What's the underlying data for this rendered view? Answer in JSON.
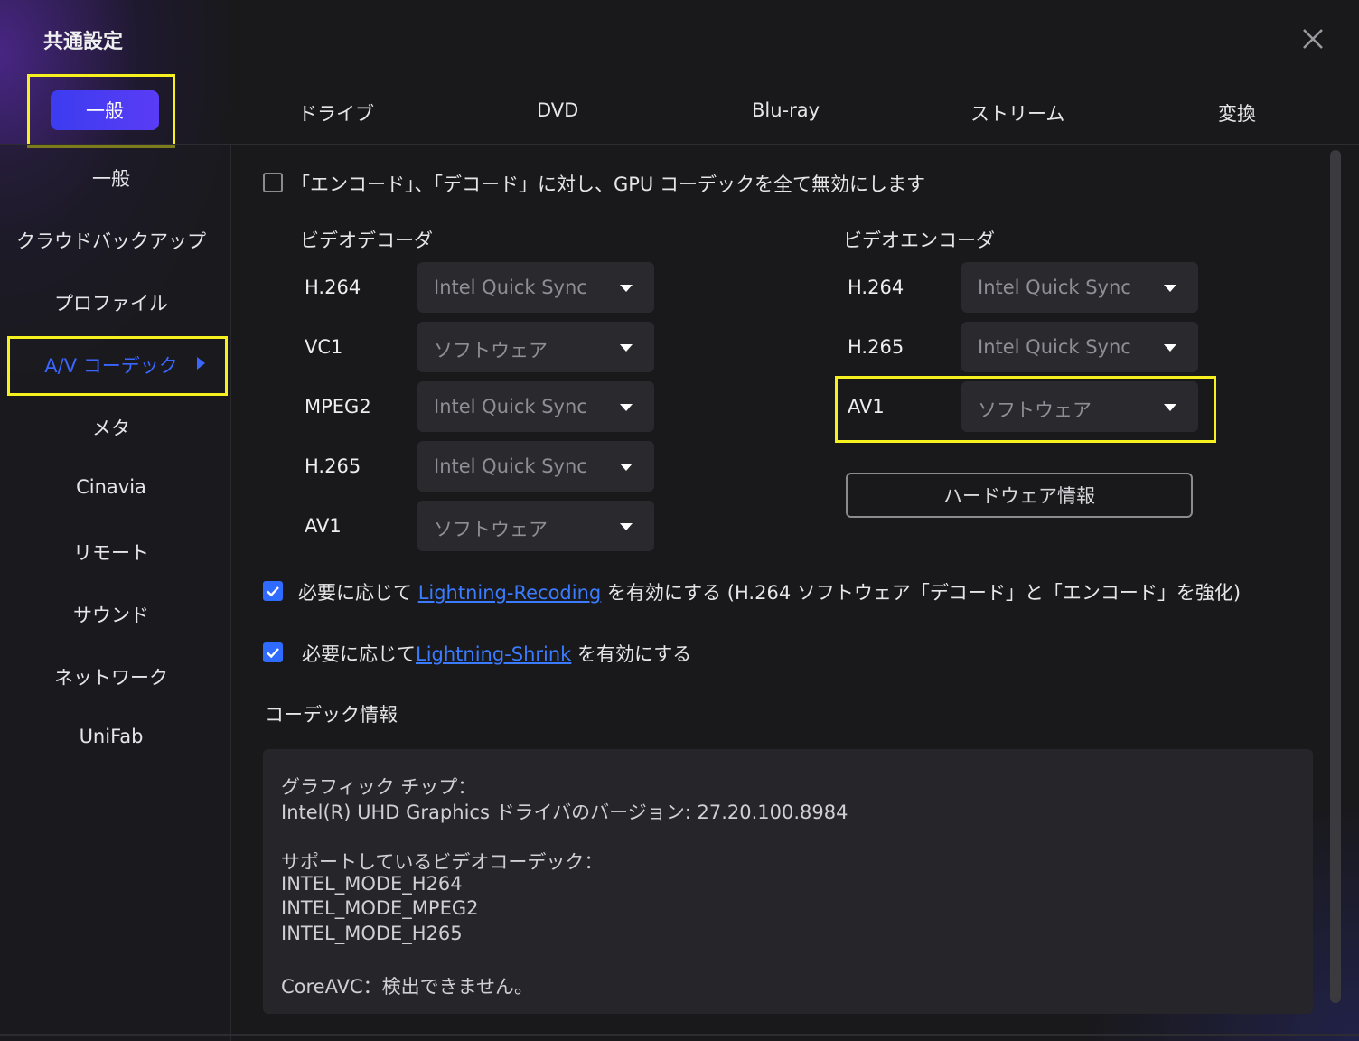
{
  "window": {
    "title": "共通設定",
    "close_icon": "close-icon",
    "accent_color": "#3a66ff",
    "highlight_color": "#f5f01e"
  },
  "top_tabs": {
    "active": "一般",
    "items": [
      "ドライブ",
      "DVD",
      "Blu-ray",
      "ストリーム",
      "変換"
    ]
  },
  "sidebar": {
    "items": [
      {
        "label": "一般"
      },
      {
        "label": "クラウドバックアップ"
      },
      {
        "label": "プロファイル"
      },
      {
        "label": "A/V コーデック",
        "active": true
      },
      {
        "label": "メタ"
      },
      {
        "label": "Cinavia"
      },
      {
        "label": "リモート"
      },
      {
        "label": "サウンド"
      },
      {
        "label": "ネットワーク"
      },
      {
        "label": "UniFab"
      }
    ]
  },
  "main": {
    "disable_gpu": {
      "checked": false,
      "label": "「エンコード」、「デコード」に対し、GPU コーデックを全て無効にします"
    },
    "video_decoder": {
      "title": "ビデオデコーダ",
      "rows": [
        {
          "codec": "H.264",
          "value": "Intel Quick Sync"
        },
        {
          "codec": "VC1",
          "value": "ソフトウェア"
        },
        {
          "codec": "MPEG2",
          "value": "Intel Quick Sync"
        },
        {
          "codec": "H.265",
          "value": "Intel Quick Sync"
        },
        {
          "codec": "AV1",
          "value": "ソフトウェア"
        }
      ]
    },
    "video_encoder": {
      "title": "ビデオエンコーダ",
      "rows": [
        {
          "codec": "H.264",
          "value": "Intel Quick Sync"
        },
        {
          "codec": "H.265",
          "value": "Intel Quick Sync"
        },
        {
          "codec": "AV1",
          "value": "ソフトウェア"
        }
      ],
      "hardware_info_button": "ハードウェア情報"
    },
    "lightning_recoding": {
      "checked": true,
      "prefix": "必要に応じて",
      "link": "Lightning-Recoding",
      "suffix": "を有効にする (H.264 ソフトウェア「デコード」と「エンコード」を強化)"
    },
    "lightning_shrink": {
      "checked": true,
      "prefix": "必要に応じて",
      "link": "Lightning-Shrink",
      "suffix": "を有効にする"
    },
    "codec_info": {
      "title": "コーデック情報",
      "lines": [
        "グラフィック チップ：",
        "Intel(R) UHD Graphics ドライバのバージョン: 27.20.100.8984",
        "サポートしているビデオコーデック：",
        "INTEL_MODE_H264",
        "INTEL_MODE_MPEG2",
        "INTEL_MODE_H265",
        "CoreAVC：検出できません。"
      ]
    }
  }
}
